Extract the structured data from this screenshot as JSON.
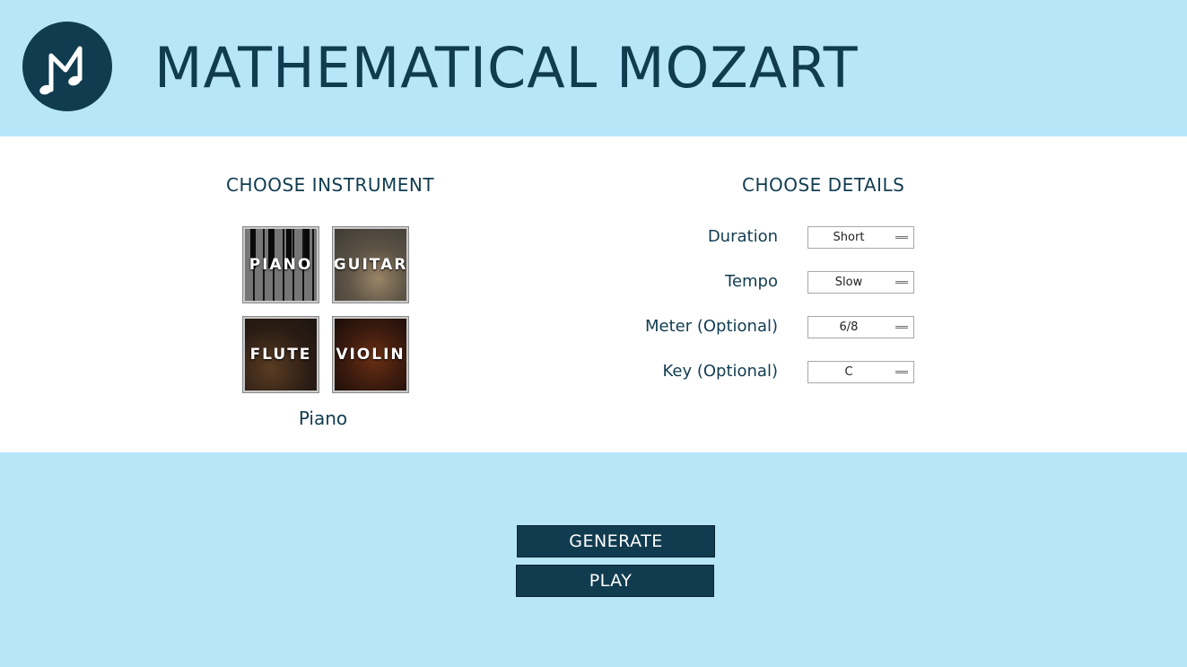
{
  "header": {
    "title": "MATHEMATICAL MOZART",
    "logo_icon": "music-note-m-logo-icon"
  },
  "instrument_section": {
    "title": "CHOOSE INSTRUMENT",
    "instruments": [
      {
        "label": "PIANO"
      },
      {
        "label": "GUITAR"
      },
      {
        "label": "FLUTE"
      },
      {
        "label": "VIOLIN"
      }
    ],
    "selected": "Piano"
  },
  "details_section": {
    "title": "CHOOSE DETAILS",
    "fields": [
      {
        "label": "Duration",
        "value": "Short"
      },
      {
        "label": "Tempo",
        "value": "Slow"
      },
      {
        "label": "Meter (Optional)",
        "value": "6/8"
      },
      {
        "label": "Key (Optional)",
        "value": "C"
      }
    ]
  },
  "actions": {
    "generate_label": "GENERATE",
    "play_label": "PLAY"
  },
  "colors": {
    "background": "#b7e6f8",
    "panel": "#ffffff",
    "primary": "#113c50"
  }
}
